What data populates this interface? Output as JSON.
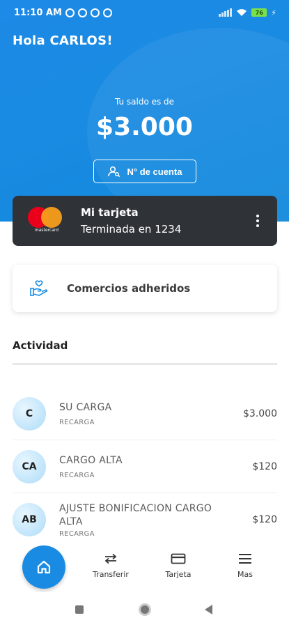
{
  "status_bar": {
    "time": "11:10 AM",
    "battery": "76"
  },
  "header": {
    "greeting": "Hola CARLOS!"
  },
  "balance": {
    "label": "Tu saldo es de",
    "amount": "$3.000",
    "account_button_label": "N° de cuenta"
  },
  "card": {
    "brand": "mastercard",
    "title": "Mi tarjeta",
    "subtitle": "Terminada en 1234"
  },
  "merchants": {
    "label": "Comercios adheridos",
    "icon": "hand-heart-icon"
  },
  "activity": {
    "title": "Actividad",
    "items": [
      {
        "initials": "C",
        "title": "SU CARGA",
        "category": "RECARGA",
        "amount": "$3.000"
      },
      {
        "initials": "CA",
        "title": "CARGO ALTA",
        "category": "RECARGA",
        "amount": "$120"
      },
      {
        "initials": "AB",
        "title": "AJUSTE BONIFICACION CARGO ALTA",
        "category": "RECARGA",
        "amount": "$120"
      }
    ]
  },
  "bottom_nav": {
    "items": [
      {
        "label": "",
        "icon": "home-icon"
      },
      {
        "label": "Transferir",
        "icon": "transfer-icon"
      },
      {
        "label": "Tarjeta",
        "icon": "card-icon"
      },
      {
        "label": "Mas",
        "icon": "menu-icon"
      }
    ]
  },
  "colors": {
    "primary": "#1a8be2",
    "card": "#2f3338",
    "avatar": "#bfe4fa"
  }
}
